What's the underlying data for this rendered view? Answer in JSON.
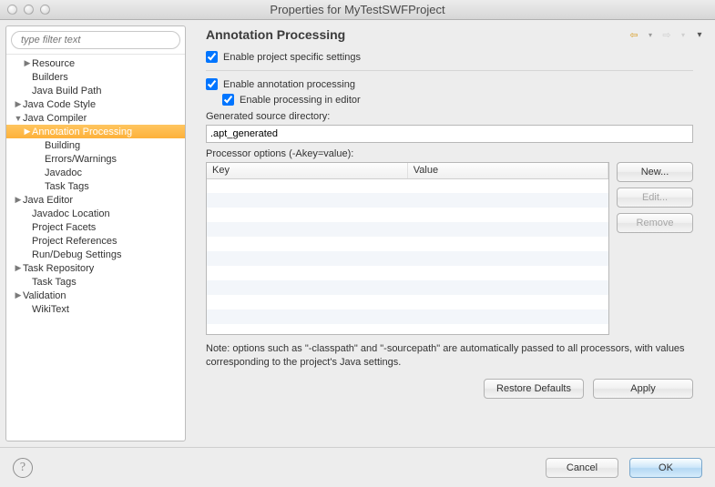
{
  "window": {
    "title": "Properties for MyTestSWFProject"
  },
  "sidebar": {
    "filter_placeholder": "type filter text",
    "items": [
      {
        "label": "Resource",
        "level": 1,
        "arrow": "col",
        "sel": false
      },
      {
        "label": "Builders",
        "level": 1,
        "arrow": "none",
        "sel": false
      },
      {
        "label": "Java Build Path",
        "level": 1,
        "arrow": "none",
        "sel": false
      },
      {
        "label": "Java Code Style",
        "level": 0,
        "arrow": "col",
        "sel": false
      },
      {
        "label": "Java Compiler",
        "level": 0,
        "arrow": "exp",
        "sel": false
      },
      {
        "label": "Annotation Processing",
        "level": 1,
        "arrow": "col",
        "sel": true
      },
      {
        "label": "Building",
        "level": 2,
        "arrow": "none",
        "sel": false
      },
      {
        "label": "Errors/Warnings",
        "level": 2,
        "arrow": "none",
        "sel": false
      },
      {
        "label": "Javadoc",
        "level": 2,
        "arrow": "none",
        "sel": false
      },
      {
        "label": "Task Tags",
        "level": 2,
        "arrow": "none",
        "sel": false
      },
      {
        "label": "Java Editor",
        "level": 0,
        "arrow": "col",
        "sel": false
      },
      {
        "label": "Javadoc Location",
        "level": 1,
        "arrow": "none",
        "sel": false
      },
      {
        "label": "Project Facets",
        "level": 1,
        "arrow": "none",
        "sel": false
      },
      {
        "label": "Project References",
        "level": 1,
        "arrow": "none",
        "sel": false
      },
      {
        "label": "Run/Debug Settings",
        "level": 1,
        "arrow": "none",
        "sel": false
      },
      {
        "label": "Task Repository",
        "level": 0,
        "arrow": "col",
        "sel": false
      },
      {
        "label": "Task Tags",
        "level": 1,
        "arrow": "none",
        "sel": false
      },
      {
        "label": "Validation",
        "level": 0,
        "arrow": "col",
        "sel": false
      },
      {
        "label": "WikiText",
        "level": 1,
        "arrow": "none",
        "sel": false
      }
    ]
  },
  "page": {
    "title": "Annotation Processing",
    "enable_project_specific": "Enable project specific settings",
    "enable_annotation_processing": "Enable annotation processing",
    "enable_processing_in_editor": "Enable processing in editor",
    "gen_src_label": "Generated source directory:",
    "gen_src_value": ".apt_generated",
    "processor_options_label": "Processor options (-Akey=value):",
    "columns": {
      "key": "Key",
      "value": "Value"
    },
    "btn_new": "New...",
    "btn_edit": "Edit...",
    "btn_remove": "Remove",
    "note": "Note: options such as \"-classpath\" and \"-sourcepath\" are automatically passed to all processors, with values corresponding to the project's Java settings.",
    "btn_restore": "Restore Defaults",
    "btn_apply": "Apply"
  },
  "footer": {
    "cancel": "Cancel",
    "ok": "OK"
  }
}
